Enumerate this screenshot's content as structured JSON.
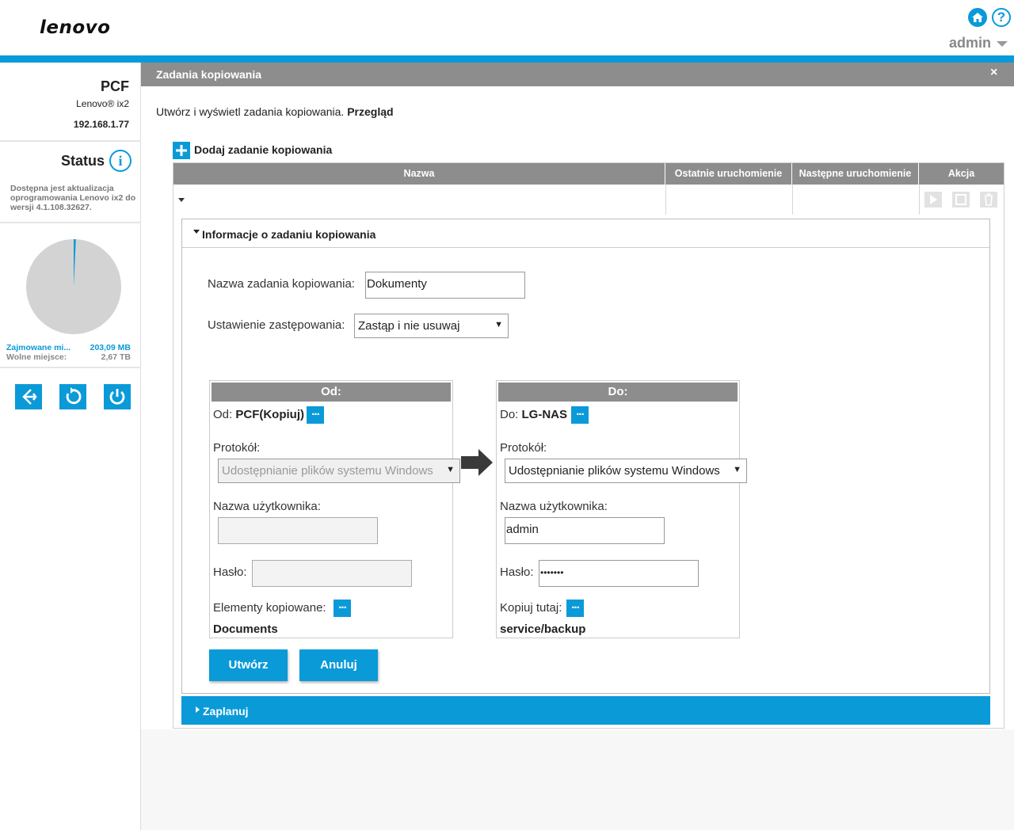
{
  "brand": {
    "logo_text": "lenovo"
  },
  "header": {
    "user": "admin",
    "help_symbol": "?"
  },
  "sidebar": {
    "device_name": "PCF",
    "device_model": "Lenovo® ix2",
    "device_ip": "192.168.1.77",
    "status_label": "Status",
    "status_info_symbol": "i",
    "update_notice": "Dostępna jest aktualizacja oprogramowania Lenovo ix2 do wersji 4.1.108.32627.",
    "storage": {
      "used_label": "Zajmowane mi...",
      "used_value": "203,09 MB",
      "free_label": "Wolne miejsce:",
      "free_value": "2,67 TB",
      "used_fraction": 0.0074
    },
    "colors": {
      "accent": "#0a9ad8",
      "pie_free": "#d3d3d3"
    }
  },
  "panel": {
    "title": "Zadania kopiowania",
    "close_symbol": "×",
    "intro_text": "Utwórz i wyświetl zadania kopiowania.",
    "intro_link": "Przegląd",
    "add_job_label": "Dodaj zadanie kopiowania"
  },
  "table": {
    "columns": [
      "Nazwa",
      "Ostatnie uruchomienie",
      "Następne uruchomienie",
      "Akcja"
    ],
    "action_icons": [
      "play-icon",
      "stop-icon",
      "trash-icon"
    ]
  },
  "job_info": {
    "section_title": "Informacje o zadaniu kopiowania",
    "name_label": "Nazwa zadania kopiowania:",
    "name_value": "Dokumenty",
    "overwrite_label": "Ustawienie zastępowania:",
    "overwrite_value": "Zastąp i nie usuwaj",
    "source": {
      "header": "Od:",
      "from_label": "Od:",
      "from_value": "PCF(Kopiuj)",
      "protocol_label": "Protokół:",
      "protocol_value": "Udostępnianie plików systemu Windows",
      "username_label": "Nazwa użytkownika:",
      "username_value": "",
      "password_label": "Hasło:",
      "password_value": "",
      "items_label": "Elementy kopiowane:",
      "items_value": "Documents"
    },
    "destination": {
      "header": "Do:",
      "to_label": "Do:",
      "to_value": "LG-NAS",
      "protocol_label": "Protokół:",
      "protocol_value": "Udostępnianie plików systemu Windows",
      "username_label": "Nazwa użytkownika:",
      "username_value": "admin",
      "password_label": "Hasło:",
      "password_value": "•••••••",
      "copy_here_label": "Kopiuj tutaj:",
      "copy_here_value": "service/backup"
    },
    "browse_symbol": "...",
    "create_label": "Utwórz",
    "cancel_label": "Anuluj"
  },
  "schedule": {
    "label": "Zaplanuj"
  }
}
